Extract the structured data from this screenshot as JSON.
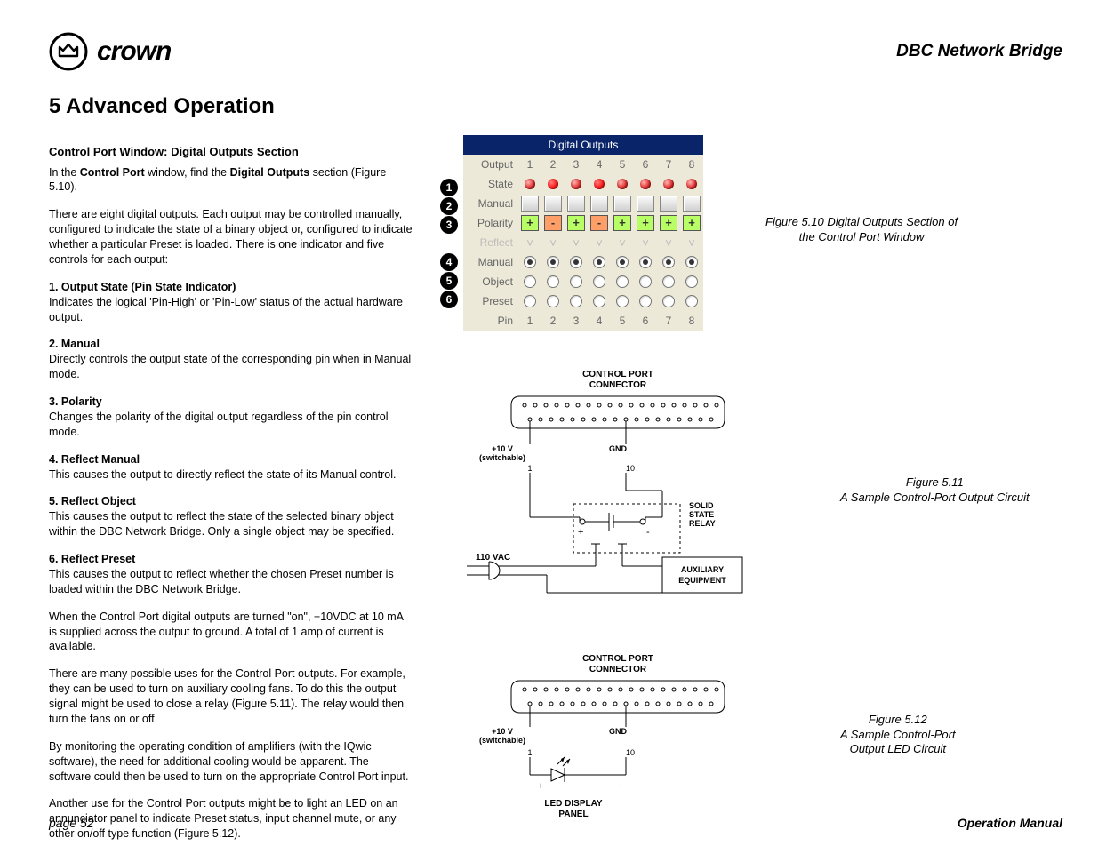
{
  "header": {
    "brand_word": "crown",
    "product": "DBC Network Bridge"
  },
  "section_title": "5 Advanced Operation",
  "left": {
    "sub1": "Control Port Window: Digital Outputs Section",
    "p1a": "In the ",
    "p1b": "Control Port",
    "p1c": " window, find the ",
    "p1d": "Digital Outputs",
    "p1e": " section (Figure 5.10).",
    "p2": "There are eight digital outputs. Each output may be controlled manually, configured to indicate the state of a binary object or, configured to indicate whether a particular Preset is loaded. There is one indicator and five controls for each output:",
    "i1h": "1. Output State (Pin State Indicator)",
    "i1b": "Indicates the logical 'Pin-High' or 'Pin-Low' status of the actual hardware output.",
    "i2h": "2. Manual",
    "i2b": "Directly controls the output state of the corresponding pin when in Manual mode.",
    "i3h": "3. Polarity",
    "i3b": "Changes the polarity of the digital output regardless of the pin control mode.",
    "i4h": "4. Reflect Manual",
    "i4b": "This causes the output to directly reflect the state of its Manual control.",
    "i5h": "5. Reflect Object",
    "i5b": "This causes the output to reflect the state of the selected binary object within the DBC Network Bridge. Only a single object may be specified.",
    "i6h": "6. Reflect Preset",
    "i6b": "This causes the output to reflect whether the chosen Preset number is loaded within the DBC Network Bridge.",
    "p3": "When the Control Port digital outputs are turned \"on\", +10VDC at 10 mA is supplied across the output to ground. A total of 1 amp of current is available.",
    "p4": "There are many possible uses for the Control Port outputs. For example, they can be used to turn on auxiliary cooling fans. To do this the output signal might be used to close a relay (Figure 5.11). The relay would then turn the fans on or off.",
    "p5": "By monitoring the operating condition of amplifiers (with the IQwic software), the need for additional cooling would be apparent. The software could then be used to turn on the appropriate Control Port input.",
    "p6": "Another use for the Control Port outputs might be to light an LED on an annunciator panel to indicate Preset status, input channel mute, or any other on/off type function (Figure 5.12)."
  },
  "chart_data": {
    "type": "table",
    "title": "Digital Outputs",
    "output_header": "Output",
    "columns": [
      "1",
      "2",
      "3",
      "4",
      "5",
      "6",
      "7",
      "8"
    ],
    "rows": [
      {
        "label": "State",
        "values": [
          "off",
          "on",
          "off",
          "on",
          "off",
          "off",
          "off",
          "off"
        ]
      },
      {
        "label": "Manual",
        "values": [
          "btn",
          "btn",
          "btn",
          "btn",
          "btn",
          "btn",
          "btn",
          "btn"
        ]
      },
      {
        "label": "Polarity",
        "values": [
          "+",
          "-",
          "+",
          "-",
          "+",
          "+",
          "+",
          "+"
        ]
      },
      {
        "label": "Reflect",
        "disabled": true,
        "values": [
          "v",
          "v",
          "v",
          "v",
          "v",
          "v",
          "v",
          "v"
        ]
      },
      {
        "label": "Manual",
        "values": [
          "sel",
          "sel",
          "sel",
          "sel",
          "sel",
          "sel",
          "sel",
          "sel"
        ]
      },
      {
        "label": "Object",
        "values": [
          "",
          "",
          "",
          "",
          "",
          "",
          "",
          ""
        ]
      },
      {
        "label": "Preset",
        "values": [
          "",
          "",
          "",
          "",
          "",
          "",
          "",
          ""
        ]
      }
    ],
    "pin_label": "Pin",
    "pins": [
      "1",
      "2",
      "3",
      "4",
      "5",
      "6",
      "7",
      "8"
    ],
    "callouts": [
      "1",
      "2",
      "3",
      "4",
      "5",
      "6"
    ]
  },
  "captions": {
    "f510a": "Figure 5.10 Digital Outputs Section of",
    "f510b": "the Control Port Window",
    "f511a": "Figure 5.11",
    "f511b": "A Sample Control-Port Output Circuit",
    "f512a": "Figure 5.12",
    "f512b": "A Sample Control-Port",
    "f512c": "Output LED Circuit"
  },
  "schem_labels": {
    "conn": "CONTROL PORT\nCONNECTOR",
    "v10": "+10 V\n(switchable)",
    "gnd": "GND",
    "pin1": "1",
    "pin10": "10",
    "ssr": "SOLID\nSTATE\nRELAY",
    "vac": "110 VAC",
    "aux": "AUXILIARY\nEQUIPMENT",
    "led": "LED DISPLAY\nPANEL"
  },
  "footer": {
    "left": "page 52",
    "right": "Operation Manual"
  }
}
